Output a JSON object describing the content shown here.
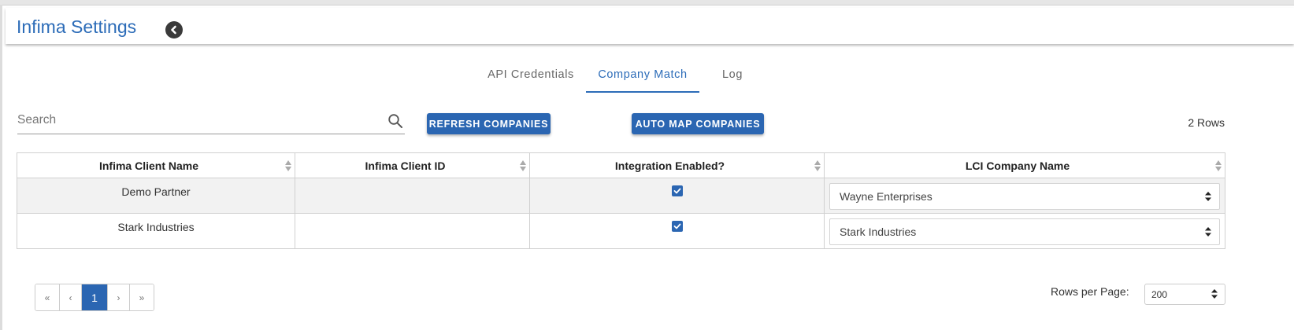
{
  "header": {
    "title": "Infima Settings"
  },
  "tabs": [
    {
      "label": "API Credentials"
    },
    {
      "label": "Company Match"
    },
    {
      "label": "Log"
    }
  ],
  "search": {
    "placeholder": "Search",
    "value": ""
  },
  "toolbar": {
    "refresh_label": "REFRESH COMPANIES",
    "automap_label": "AUTO MAP COMPANIES",
    "rows_count": "2 Rows"
  },
  "table": {
    "columns": [
      "Infima Client Name",
      "Infima Client ID",
      "Integration Enabled?",
      "LCI Company Name"
    ],
    "rows": [
      {
        "client_name": "Demo Partner",
        "client_id": "",
        "integration_enabled": true,
        "lci_company": "Wayne Enterprises"
      },
      {
        "client_name": "Stark Industries",
        "client_id": "",
        "integration_enabled": true,
        "lci_company": "Stark Industries"
      }
    ]
  },
  "pagination": {
    "first": "«",
    "prev": "‹",
    "current": "1",
    "next": "›",
    "last": "»",
    "rows_per_page_label": "Rows per Page:",
    "rows_per_page_value": "200"
  },
  "colors": {
    "accent": "#2b66b2",
    "title": "#2c6cb8"
  },
  "icons": {
    "back": "chevron-left-circle-icon",
    "search": "search-icon",
    "sort": "sort-icon",
    "checkbox": "checkbox-checked-icon",
    "caret": "select-caret-icon"
  }
}
